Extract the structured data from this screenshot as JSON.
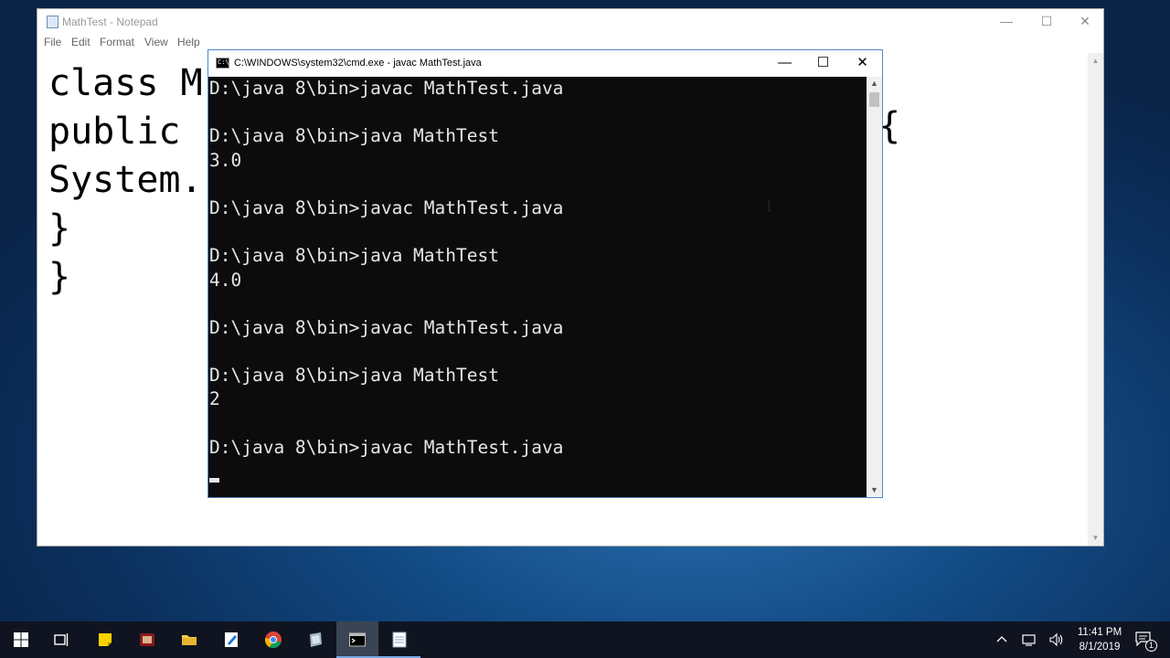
{
  "notepad": {
    "title": "MathTest - Notepad",
    "menu": [
      "File",
      "Edit",
      "Format",
      "View",
      "Help"
    ],
    "lines": [
      "class M",
      "public ",
      "System.",
      "}",
      "}"
    ],
    "partial_brace": "{"
  },
  "cmd": {
    "title": "C:\\WINDOWS\\system32\\cmd.exe - javac  MathTest.java",
    "lines": [
      "D:\\java 8\\bin>javac MathTest.java",
      "",
      "D:\\java 8\\bin>java MathTest",
      "3.0",
      "",
      "D:\\java 8\\bin>javac MathTest.java",
      "",
      "D:\\java 8\\bin>java MathTest",
      "4.0",
      "",
      "D:\\java 8\\bin>javac MathTest.java",
      "",
      "D:\\java 8\\bin>java MathTest",
      "2",
      "",
      "D:\\java 8\\bin>javac MathTest.java"
    ]
  },
  "window_controls": {
    "minimize": "—",
    "maximize": "☐",
    "close": "✕"
  },
  "taskbar": {
    "apps": [
      {
        "name": "start",
        "icon": "windows-logo-icon"
      },
      {
        "name": "task-view",
        "icon": "task-view-icon"
      },
      {
        "name": "sticky-notes",
        "icon": "sticky-notes-icon"
      },
      {
        "name": "app-red",
        "icon": "app-icon"
      },
      {
        "name": "file-explorer",
        "icon": "folder-icon"
      },
      {
        "name": "editor",
        "icon": "editor-icon"
      },
      {
        "name": "chrome",
        "icon": "chrome-icon"
      },
      {
        "name": "app-gray",
        "icon": "app-icon"
      },
      {
        "name": "command-prompt",
        "icon": "cmd-icon"
      },
      {
        "name": "notepad",
        "icon": "notepad-icon"
      }
    ],
    "time": "11:41 PM",
    "date": "8/1/2019",
    "notification_count": "1"
  }
}
